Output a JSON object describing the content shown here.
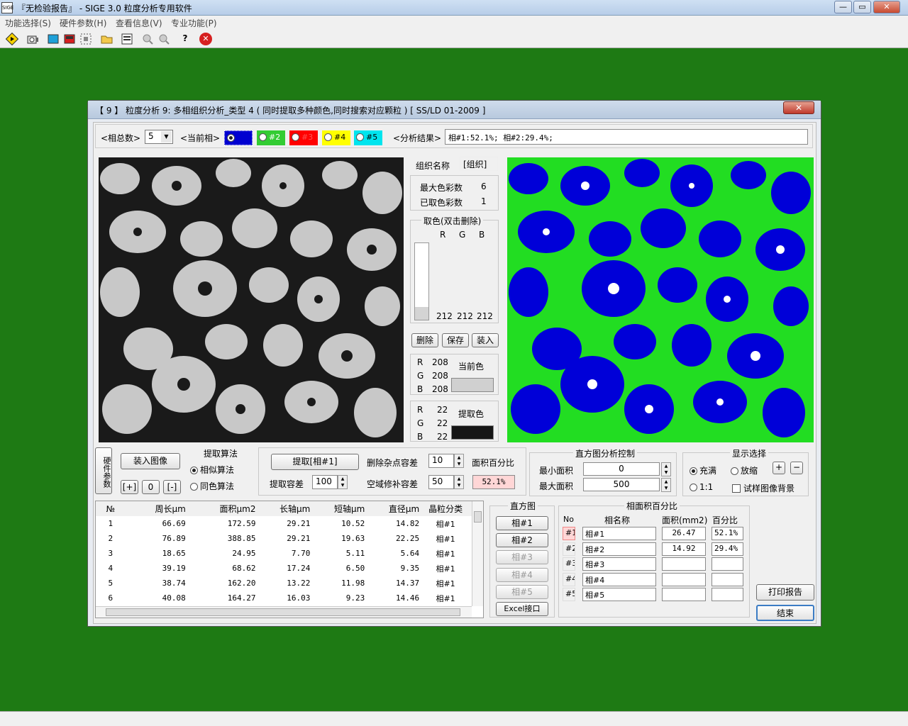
{
  "window": {
    "title": "『无检验报告』 - SIGE 3.0 粒度分析专用软件",
    "app_icon": "SIGE",
    "min": "—",
    "max": "▭",
    "close": "✕"
  },
  "menu": [
    "功能选择(S)",
    "硬件参数(H)",
    "查看信息(V)",
    "专业功能(P)"
  ],
  "toolbar": {
    "icons": [
      "play-diamond-icon",
      "camera-icon",
      "screen-icon",
      "red-screen-icon",
      "grid-icon",
      "open-folder-icon",
      "properties-icon",
      "zoom-in-icon",
      "zoom-out-icon",
      "help-icon",
      "close-circle-icon"
    ],
    "help_glyph": "?",
    "close_glyph": "✕"
  },
  "dialog": {
    "title": "【 9 】 粒度分析 9: 多相组织分析_类型 4 ( 同时提取多种颜色,同时搜索对应颗粒 ) [ SS/LD 01-2009 ]",
    "close": "✕",
    "phase_total_label": "<相总数>",
    "phase_total_value": "5",
    "current_phase_label": "<当前相>",
    "phases": [
      {
        "label": "",
        "color": "#0000d0",
        "text_color": "#fff"
      },
      {
        "label": "#2",
        "color": "#33cc33",
        "text_color": "#fff"
      },
      {
        "label": "#3",
        "color": "#ff0000",
        "text_color": "#ff5050"
      },
      {
        "label": "#4",
        "color": "#ffff00",
        "text_color": "#000"
      },
      {
        "label": "#5",
        "color": "#00e5ee",
        "text_color": "#000"
      }
    ],
    "result_label": "<分析结果>",
    "result_value": "相#1:52.1%; 相#2:29.4%;",
    "org_name_label": "组织名称",
    "org_name_value": "[组织]",
    "max_colors_label": "最大色彩数",
    "max_colors_value": "6",
    "taken_colors_label": "已取色彩数",
    "taken_colors_value": "1",
    "pick_color_title": "取色(双击删除)",
    "rgb_headers": [
      "R",
      "G",
      "B"
    ],
    "picked_rgb": [
      "212",
      "212",
      "212"
    ],
    "btn_delete": "删除",
    "btn_save": "保存",
    "btn_load": "装入",
    "current_color": {
      "label": "当前色",
      "r": "208",
      "g": "208",
      "b": "208",
      "swatch": "#d0d0d0"
    },
    "extract_color": {
      "label": "提取色",
      "r": "22",
      "g": "22",
      "b": "22",
      "swatch": "#161616"
    },
    "rgb_letters": [
      "R",
      "G",
      "B"
    ],
    "hw_params_label": "硬件参数",
    "load_image": "装入图像",
    "zoom_btns": [
      "[+]",
      "0",
      "[-]"
    ],
    "algo_title": "提取算法",
    "algo_similar": "相似算法",
    "algo_same": "同色算法",
    "extract_btn": "提取[相#1]",
    "extract_tol_label": "提取容差",
    "extract_tol_value": "100",
    "noise_label": "删除杂点容差",
    "noise_value": "10",
    "fill_label": "空域修补容差",
    "fill_value": "50",
    "area_pct_label": "面积百分比",
    "area_pct_value": "52.1%",
    "hist_title": "直方图分析控制",
    "min_area_label": "最小面积",
    "min_area_value": "0",
    "max_area_label": "最大面积",
    "max_area_value": "500",
    "display_title": "显示选择",
    "disp_fill": "充满",
    "disp_zoom": "放缩",
    "disp_1to1": "1:1",
    "disp_bg": "试样图像背景",
    "table": {
      "headers": [
        "№",
        "周长μm",
        "面积μm2",
        "长轴μm",
        "短轴μm",
        "直径μm",
        "晶粒分类"
      ],
      "rows": [
        [
          "1",
          "66.69",
          "172.59",
          "29.21",
          "10.52",
          "14.82",
          "相#1"
        ],
        [
          "2",
          "76.89",
          "388.85",
          "29.21",
          "19.63",
          "22.25",
          "相#1"
        ],
        [
          "3",
          "18.65",
          "24.95",
          "7.70",
          "5.11",
          "5.64",
          "相#1"
        ],
        [
          "4",
          "39.19",
          "68.62",
          "17.24",
          "6.50",
          "9.35",
          "相#1"
        ],
        [
          "5",
          "38.74",
          "162.20",
          "13.22",
          "11.98",
          "14.37",
          "相#1"
        ],
        [
          "6",
          "40.08",
          "164.27",
          "16.03",
          "9.23",
          "14.46",
          "相#1"
        ]
      ]
    },
    "hist_btns_title": "直方图",
    "hist_btns": [
      "相#1",
      "相#2",
      "相#3",
      "相#4",
      "相#5"
    ],
    "excel_btn": "Excel接口",
    "phase_area_title": "相面积百分比",
    "phase_area_headers": [
      "No",
      "相名称",
      "面积(mm2)",
      "百分比"
    ],
    "phase_area_rows": [
      [
        "#1",
        "相#1",
        "26.47",
        "52.1%"
      ],
      [
        "#2",
        "相#2",
        "14.92",
        "29.4%"
      ],
      [
        "#3",
        "相#3",
        "",
        ""
      ],
      [
        "#4",
        "相#4",
        "",
        ""
      ],
      [
        "#5",
        "相#5",
        "",
        ""
      ]
    ],
    "print_btn": "打印报告",
    "end_btn": "结束"
  }
}
